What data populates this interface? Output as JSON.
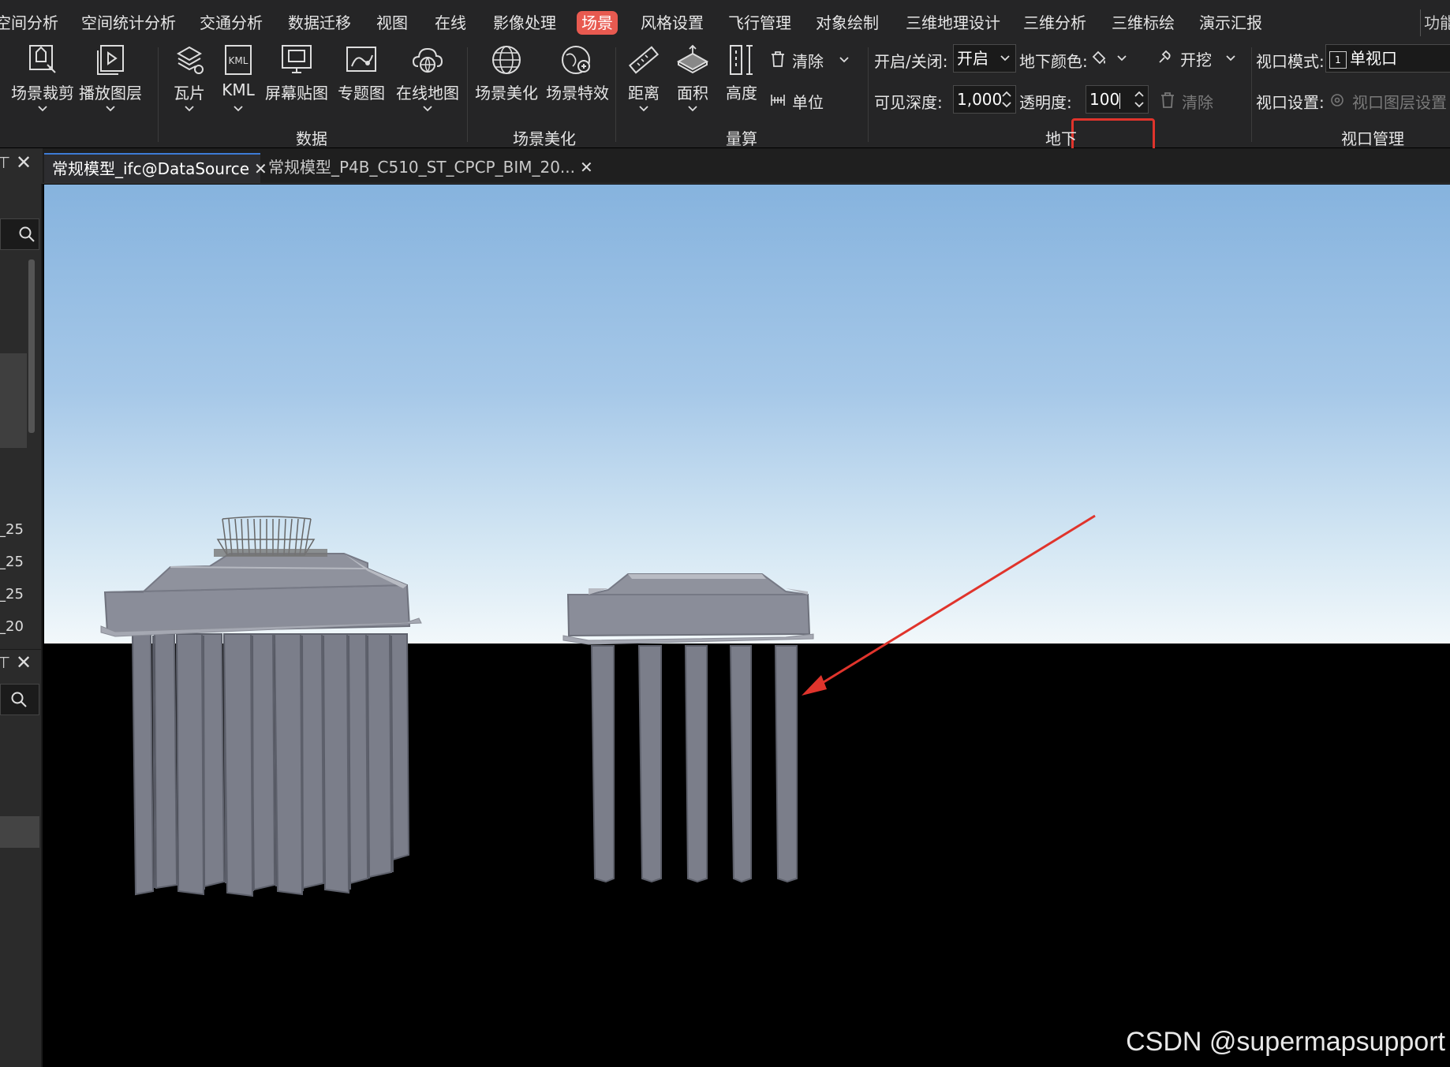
{
  "menubar": {
    "items": [
      "空间分析",
      "空间统计分析",
      "交通分析",
      "数据迁移",
      "视图",
      "在线",
      "影像处理",
      "场景",
      "风格设置",
      "飞行管理",
      "对象绘制",
      "三维地理设计",
      "三维分析",
      "三维标绘",
      "演示汇报"
    ],
    "active": "场景",
    "corner": "功能"
  },
  "ribbon": {
    "data_group": {
      "label": "数据",
      "buttons": {
        "scene_clip": "场景裁剪",
        "play_layer": "播放图层",
        "tile": "瓦片",
        "kml": "KML",
        "screen_map": "屏幕贴图",
        "thematic": "专题图",
        "online_map": "在线地图"
      },
      "kml_icon_text": "KML"
    },
    "beautify_group": {
      "label": "场景美化",
      "buttons": {
        "beautify": "场景美化",
        "effects": "场景特效"
      }
    },
    "measure_group": {
      "label": "量算",
      "buttons": {
        "distance": "距离",
        "area": "面积",
        "height": "高度"
      },
      "clear": "清除",
      "unit": "单位"
    },
    "underground_group": {
      "label": "地下",
      "onoff_label": "开启/关闭:",
      "onoff_value": "开启",
      "color_label": "地下颜色:",
      "excavate": "开挖",
      "depth_label": "可见深度:",
      "depth_value": "1,000",
      "transparency_label": "透明度:",
      "transparency_value": "100",
      "clear": "清除"
    },
    "viewport_group": {
      "label": "视口管理",
      "mode_label": "视口模式:",
      "mode_icon_text": "1",
      "mode_value": "单视口",
      "settings_label": "视口设置:",
      "settings_value": "视口图层设置"
    }
  },
  "tabs": [
    {
      "label": "常规模型_ifc@DataSource",
      "active": true
    },
    {
      "label": "常规模型_P4B_C510_ST_CPCP_BIM_20...",
      "active": false
    }
  ],
  "left_panel": {
    "rows": [
      "_25",
      "_25",
      "_25",
      "_20"
    ]
  },
  "watermark": "CSDN @supermapsupport",
  "colors": {
    "ribbon_bg": "#252526",
    "active_menu": "#e85a50",
    "highlight_box": "#e0342c",
    "annotation_arrow": "#e0342c"
  }
}
